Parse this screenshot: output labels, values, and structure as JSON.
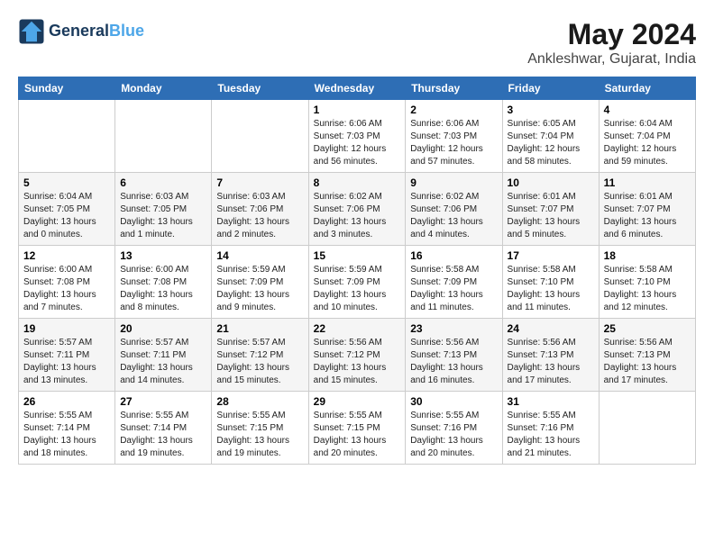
{
  "header": {
    "logo_line1": "General",
    "logo_line2": "Blue",
    "month_year": "May 2024",
    "location": "Ankleshwar, Gujarat, India"
  },
  "days_of_week": [
    "Sunday",
    "Monday",
    "Tuesday",
    "Wednesday",
    "Thursday",
    "Friday",
    "Saturday"
  ],
  "weeks": [
    [
      {
        "day": "",
        "info": ""
      },
      {
        "day": "",
        "info": ""
      },
      {
        "day": "",
        "info": ""
      },
      {
        "day": "1",
        "info": "Sunrise: 6:06 AM\nSunset: 7:03 PM\nDaylight: 12 hours and 56 minutes."
      },
      {
        "day": "2",
        "info": "Sunrise: 6:06 AM\nSunset: 7:03 PM\nDaylight: 12 hours and 57 minutes."
      },
      {
        "day": "3",
        "info": "Sunrise: 6:05 AM\nSunset: 7:04 PM\nDaylight: 12 hours and 58 minutes."
      },
      {
        "day": "4",
        "info": "Sunrise: 6:04 AM\nSunset: 7:04 PM\nDaylight: 12 hours and 59 minutes."
      }
    ],
    [
      {
        "day": "5",
        "info": "Sunrise: 6:04 AM\nSunset: 7:05 PM\nDaylight: 13 hours and 0 minutes."
      },
      {
        "day": "6",
        "info": "Sunrise: 6:03 AM\nSunset: 7:05 PM\nDaylight: 13 hours and 1 minute."
      },
      {
        "day": "7",
        "info": "Sunrise: 6:03 AM\nSunset: 7:06 PM\nDaylight: 13 hours and 2 minutes."
      },
      {
        "day": "8",
        "info": "Sunrise: 6:02 AM\nSunset: 7:06 PM\nDaylight: 13 hours and 3 minutes."
      },
      {
        "day": "9",
        "info": "Sunrise: 6:02 AM\nSunset: 7:06 PM\nDaylight: 13 hours and 4 minutes."
      },
      {
        "day": "10",
        "info": "Sunrise: 6:01 AM\nSunset: 7:07 PM\nDaylight: 13 hours and 5 minutes."
      },
      {
        "day": "11",
        "info": "Sunrise: 6:01 AM\nSunset: 7:07 PM\nDaylight: 13 hours and 6 minutes."
      }
    ],
    [
      {
        "day": "12",
        "info": "Sunrise: 6:00 AM\nSunset: 7:08 PM\nDaylight: 13 hours and 7 minutes."
      },
      {
        "day": "13",
        "info": "Sunrise: 6:00 AM\nSunset: 7:08 PM\nDaylight: 13 hours and 8 minutes."
      },
      {
        "day": "14",
        "info": "Sunrise: 5:59 AM\nSunset: 7:09 PM\nDaylight: 13 hours and 9 minutes."
      },
      {
        "day": "15",
        "info": "Sunrise: 5:59 AM\nSunset: 7:09 PM\nDaylight: 13 hours and 10 minutes."
      },
      {
        "day": "16",
        "info": "Sunrise: 5:58 AM\nSunset: 7:09 PM\nDaylight: 13 hours and 11 minutes."
      },
      {
        "day": "17",
        "info": "Sunrise: 5:58 AM\nSunset: 7:10 PM\nDaylight: 13 hours and 11 minutes."
      },
      {
        "day": "18",
        "info": "Sunrise: 5:58 AM\nSunset: 7:10 PM\nDaylight: 13 hours and 12 minutes."
      }
    ],
    [
      {
        "day": "19",
        "info": "Sunrise: 5:57 AM\nSunset: 7:11 PM\nDaylight: 13 hours and 13 minutes."
      },
      {
        "day": "20",
        "info": "Sunrise: 5:57 AM\nSunset: 7:11 PM\nDaylight: 13 hours and 14 minutes."
      },
      {
        "day": "21",
        "info": "Sunrise: 5:57 AM\nSunset: 7:12 PM\nDaylight: 13 hours and 15 minutes."
      },
      {
        "day": "22",
        "info": "Sunrise: 5:56 AM\nSunset: 7:12 PM\nDaylight: 13 hours and 15 minutes."
      },
      {
        "day": "23",
        "info": "Sunrise: 5:56 AM\nSunset: 7:13 PM\nDaylight: 13 hours and 16 minutes."
      },
      {
        "day": "24",
        "info": "Sunrise: 5:56 AM\nSunset: 7:13 PM\nDaylight: 13 hours and 17 minutes."
      },
      {
        "day": "25",
        "info": "Sunrise: 5:56 AM\nSunset: 7:13 PM\nDaylight: 13 hours and 17 minutes."
      }
    ],
    [
      {
        "day": "26",
        "info": "Sunrise: 5:55 AM\nSunset: 7:14 PM\nDaylight: 13 hours and 18 minutes."
      },
      {
        "day": "27",
        "info": "Sunrise: 5:55 AM\nSunset: 7:14 PM\nDaylight: 13 hours and 19 minutes."
      },
      {
        "day": "28",
        "info": "Sunrise: 5:55 AM\nSunset: 7:15 PM\nDaylight: 13 hours and 19 minutes."
      },
      {
        "day": "29",
        "info": "Sunrise: 5:55 AM\nSunset: 7:15 PM\nDaylight: 13 hours and 20 minutes."
      },
      {
        "day": "30",
        "info": "Sunrise: 5:55 AM\nSunset: 7:16 PM\nDaylight: 13 hours and 20 minutes."
      },
      {
        "day": "31",
        "info": "Sunrise: 5:55 AM\nSunset: 7:16 PM\nDaylight: 13 hours and 21 minutes."
      },
      {
        "day": "",
        "info": ""
      }
    ]
  ]
}
